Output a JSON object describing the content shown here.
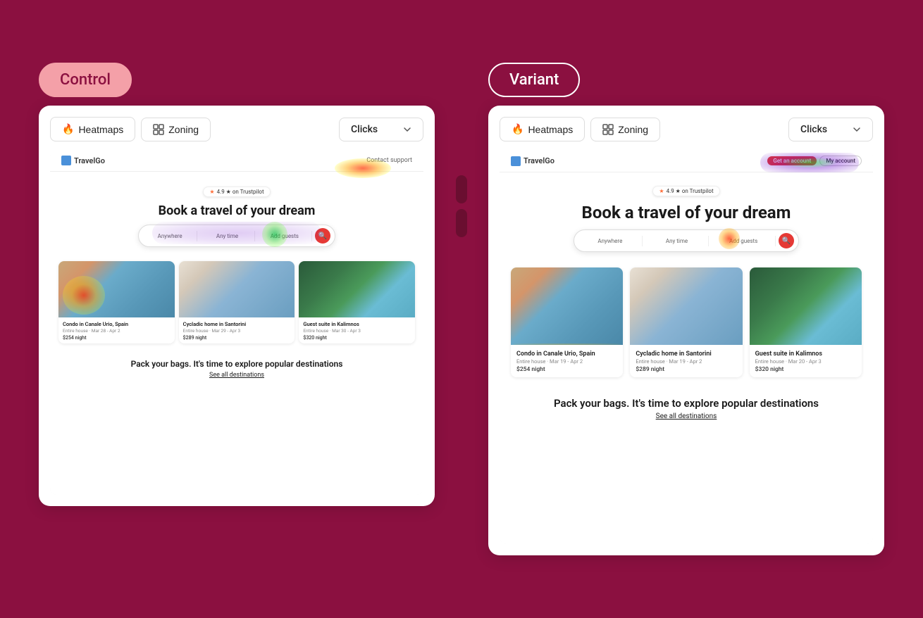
{
  "background_color": "#8B1040",
  "control": {
    "label": "Control",
    "heatmaps_btn": "Heatmaps",
    "zoning_btn": "Zoning",
    "clicks_label": "Clicks",
    "mockup": {
      "logo": "TravelGo",
      "nav_right": "Contact support",
      "rating": "4.9 ★ on Trustpilot",
      "hero_title": "Book a travel of your dream",
      "search_field1": "Anywhere",
      "search_field2": "Any time",
      "search_field3": "Add guests",
      "cards": [
        {
          "title": "Condo in Canale Urio, Spain",
          "subtitle": "Entire house · Mar 28 - Apr 2",
          "price": "$254 night"
        },
        {
          "title": "Cycladic home in Santorini",
          "subtitle": "Entire house · Mar 29 - Apr 3",
          "price": "$289 night"
        },
        {
          "title": "Guest suite in Kalimnos",
          "subtitle": "Entire house · Mar 30 - Apr 3",
          "price": "$320 night"
        }
      ],
      "footer_title": "Pack your bags. It's time to explore popular destinations",
      "footer_link": "See all destinations"
    }
  },
  "variant": {
    "label": "Variant",
    "heatmaps_btn": "Heatmaps",
    "zoning_btn": "Zoning",
    "clicks_label": "Clicks",
    "mockup": {
      "logo": "TravelGo",
      "nav_pill1": "Get an account",
      "nav_pill2": "My account",
      "rating": "4.9 ★ on Trustpilot",
      "hero_title": "Book a travel of your dream",
      "search_field1": "Anywhere",
      "search_field2": "Any time",
      "search_field3": "Add guests",
      "cards": [
        {
          "title": "Condo in Canale Urio, Spain",
          "subtitle": "Entire house · Mar 19 - Apr 2",
          "price": "$254 night"
        },
        {
          "title": "Cycladic home in Santorini",
          "subtitle": "Entire house · Mar 19 - Apr 2",
          "price": "$289 night"
        },
        {
          "title": "Guest suite in Kalimnos",
          "subtitle": "Entire house · Mar 20 - Apr 3",
          "price": "$320 night"
        }
      ],
      "footer_title": "Pack your bags. It's time to explore popular destinations",
      "footer_link": "See all destinations"
    }
  }
}
